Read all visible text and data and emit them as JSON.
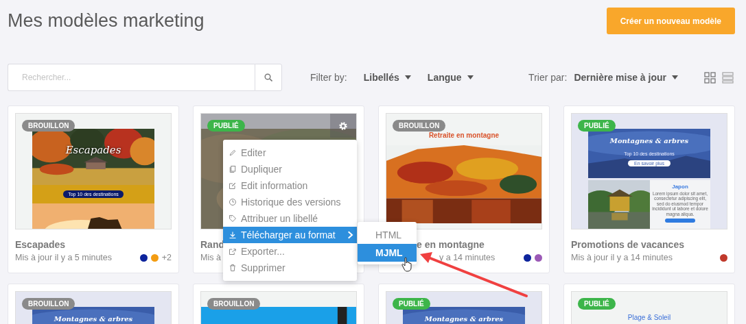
{
  "page_title": "Mes modèles marketing",
  "create_button": "Créer un nouveau modèle",
  "toolbar": {
    "search": {
      "placeholder": "Rechercher..."
    },
    "filter_label": "Filter by:",
    "filters": [
      "Libellés",
      "Langue"
    ],
    "sort_label": "Trier par:",
    "sort_value": "Dernière mise à jour"
  },
  "cards": [
    {
      "badge": {
        "label": "BROUILLON",
        "color": "#8a8a8a"
      },
      "hovered": false,
      "preview": {
        "kind": "banner",
        "title": "Escapades",
        "button": "Top 10 des destinations"
      },
      "title": "Escapades",
      "subtitle": "Mis à jour il y a 5 minutes",
      "labels": [
        {
          "color": "#0d249c"
        },
        {
          "color": "#f39c12"
        }
      ],
      "more": "+2"
    },
    {
      "badge": {
        "label": "PUBLIÉ",
        "color": "#3db54a"
      },
      "hovered": true,
      "title": "Rand",
      "subtitle": "Mis à"
    },
    {
      "badge": {
        "label": "BROUILLON",
        "color": "#8a8a8a"
      },
      "hovered": false,
      "preview": {
        "kind": "headline",
        "title": "Retraite en montagne"
      },
      "title": "e en montagne",
      "subtitle": "y a 14 minutes",
      "cut_left": true,
      "labels": [
        {
          "color": "#0d249c"
        },
        {
          "color": "#9b59b6"
        }
      ]
    },
    {
      "badge": {
        "label": "PUBLIÉ",
        "color": "#3db54a"
      },
      "hovered": false,
      "preview": {
        "kind": "newsletter",
        "title": "Montagnes & arbres",
        "subtitle": "Top 10 des destinations",
        "button": "En savoir plus",
        "heading": "Japon",
        "body": "Lorem ipsum dolor sit amet, consectetur adipiscing elit, sed do eiusmod tempor incididunt ut labore et dolore magna aliqua."
      },
      "title": "Promotions de vacances",
      "subtitle": "Mis à jour il y a 14 minutes",
      "labels": [
        {
          "color": "#c0392b"
        }
      ]
    },
    {
      "badge": {
        "label": "BROUILLON",
        "color": "#8a8a8a"
      },
      "hovered": false,
      "preview": {
        "kind": "newsletter",
        "title": "Montagnes & arbres"
      }
    },
    {
      "badge": {
        "label": "BROUILLON",
        "color": "#8a8a8a"
      },
      "hovered": false
    },
    {
      "badge": {
        "label": "PUBLIÉ",
        "color": "#3db54a"
      },
      "hovered": false,
      "preview": {
        "kind": "newsletter",
        "title": "Montagnes & arbres"
      }
    },
    {
      "badge": {
        "label": "PUBLIÉ",
        "color": "#3db54a"
      },
      "hovered": false,
      "preview": {
        "kind": "plain",
        "title": "Plage & Soleil"
      }
    }
  ],
  "context_menu": {
    "items": [
      {
        "label": "Editer",
        "selected": false
      },
      {
        "label": "Dupliquer",
        "selected": false
      },
      {
        "label": "Edit information",
        "selected": false
      },
      {
        "label": "Historique des versions",
        "selected": false
      },
      {
        "label": "Attribuer un libellé",
        "selected": false
      },
      {
        "label": "Télécharger au format",
        "selected": true,
        "submenu": true
      },
      {
        "label": "Exporter...",
        "selected": false
      },
      {
        "label": "Supprimer",
        "selected": false
      }
    ],
    "submenu": [
      {
        "label": "HTML",
        "selected": false
      },
      {
        "label": "MJML",
        "selected": true
      }
    ]
  }
}
